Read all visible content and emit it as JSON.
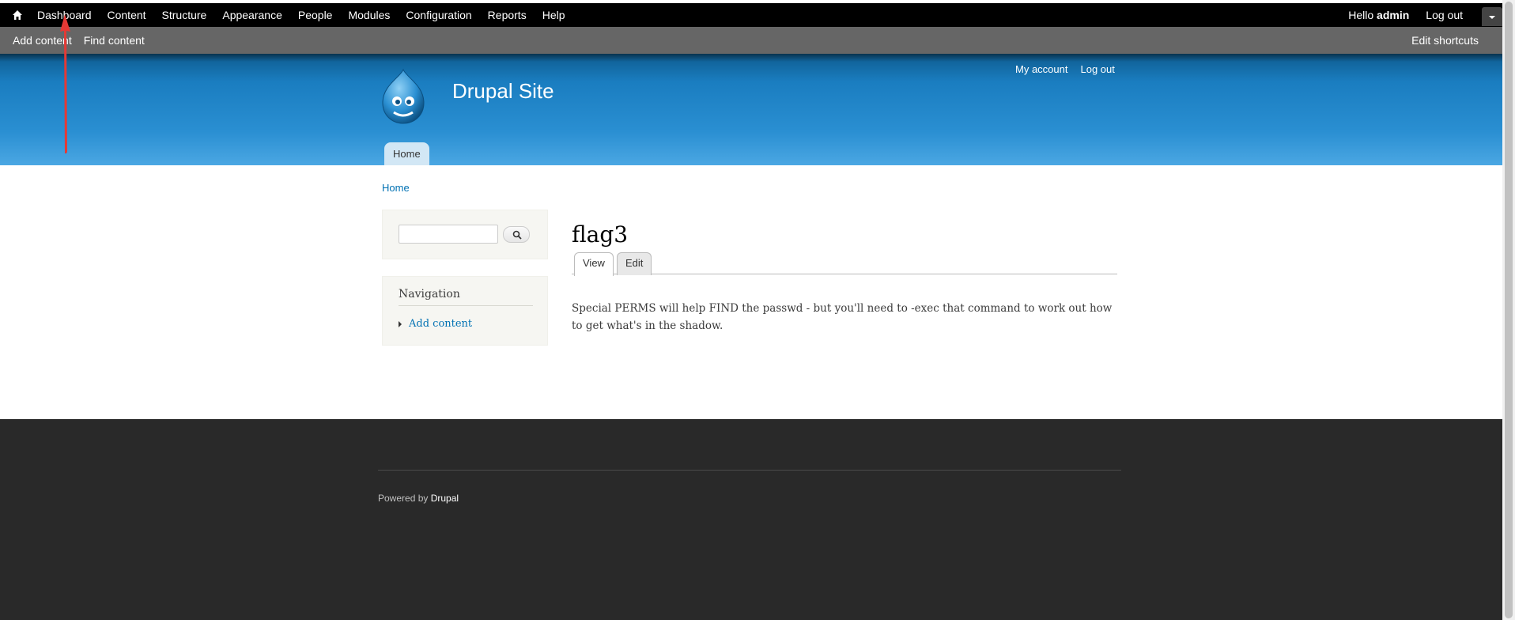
{
  "admin_menu": {
    "items": [
      "Dashboard",
      "Content",
      "Structure",
      "Appearance",
      "People",
      "Modules",
      "Configuration",
      "Reports",
      "Help"
    ],
    "hello_prefix": "Hello",
    "username": "admin",
    "logout": "Log out"
  },
  "shortcuts": {
    "add_content": "Add content",
    "find_content": "Find content",
    "edit_shortcuts": "Edit shortcuts"
  },
  "header": {
    "site_name": "Drupal Site",
    "my_account": "My account",
    "logout": "Log out",
    "main_tab": "Home"
  },
  "breadcrumb": "Home",
  "sidebar": {
    "search_placeholder": "",
    "nav_title": "Navigation",
    "nav_item": "Add content"
  },
  "page": {
    "title": "flag3",
    "tab_view": "View",
    "tab_edit": "Edit",
    "body": "Special PERMS will help FIND the passwd - but you'll need to -exec that command to work out how to get what's in the shadow."
  },
  "footer": {
    "powered_by": "Powered by",
    "drupal_link": "Drupal"
  },
  "colors": {
    "link": "#0071b3",
    "header_blue": "#1a7dc0",
    "annotation_arrow": "#e53935"
  },
  "icons": {
    "home": "home-icon",
    "search": "search-icon",
    "toggle": "chevron-down-icon",
    "logo": "drupal-logo-icon"
  }
}
